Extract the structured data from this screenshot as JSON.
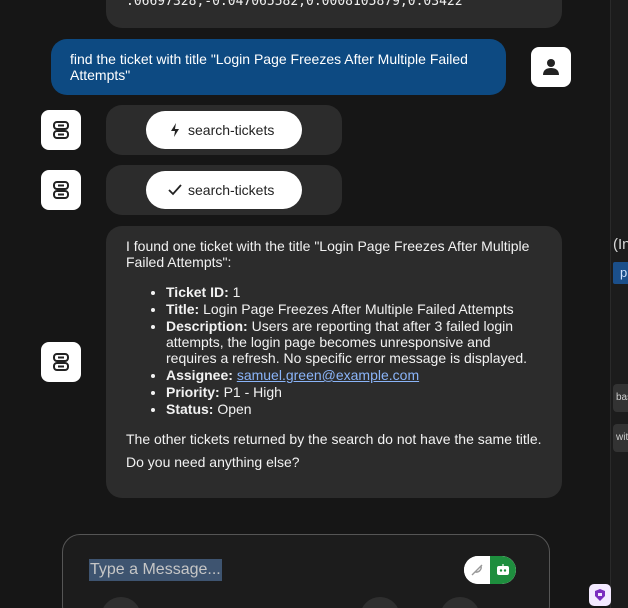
{
  "previous_output": {
    "text": ".06697328,-0.047065582,0.0008105879,0.03422"
  },
  "user_message": {
    "text": "find the ticket with title \"Login Page Freezes After Multiple Failed Attempts\""
  },
  "tool_calls": [
    {
      "name": "search-tickets",
      "status_icon": "lightning-icon"
    },
    {
      "name": "search-tickets",
      "status_icon": "checkmark-icon"
    }
  ],
  "answer": {
    "intro": "I found one ticket with the title \"Login Page Freezes After Multiple Failed Attempts\":",
    "fields": [
      {
        "label": "Ticket ID:",
        "value": "1"
      },
      {
        "label": "Title:",
        "value": "Login Page Freezes After Multiple Failed Attempts"
      },
      {
        "label": "Description:",
        "value": "Users are reporting that after 3 failed login attempts, the login page becomes unresponsive and requires a refresh. No specific error message is displayed."
      },
      {
        "label": "Assignee:",
        "value": "samuel.green@example.com"
      },
      {
        "label": "Priority:",
        "value": "P1 - High"
      },
      {
        "label": "Status:",
        "value": "Open"
      }
    ],
    "note": "The other tickets returned by the search do not have the same title.",
    "followup": "Do you need anything else?"
  },
  "composer": {
    "placeholder": "Type a Message..."
  },
  "right_panel": {
    "heading_fragment": "(In",
    "bar_fragment": "p",
    "pill1_fragment": "bas",
    "pill2_fragment": "wit"
  },
  "colors": {
    "user_bubble": "#0d4a82",
    "assistant_bubble": "#2c2c2c",
    "background": "#161616",
    "link": "#8ab4f8",
    "send_button": "#1e8e3e"
  }
}
